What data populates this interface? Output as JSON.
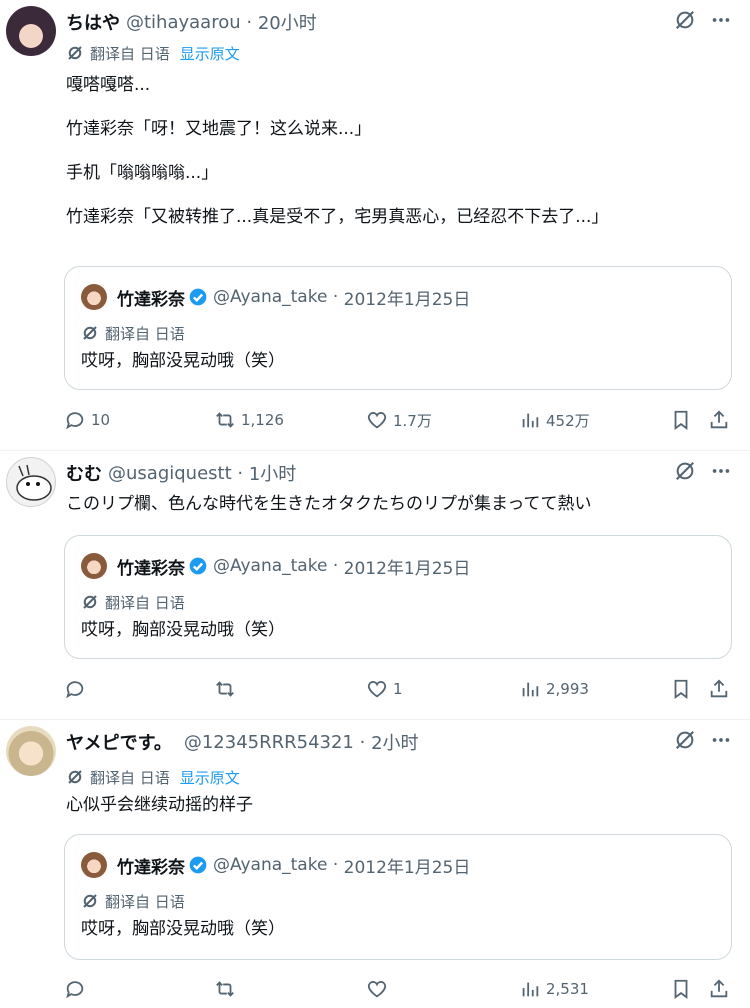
{
  "quoted": {
    "name": "竹達彩奈",
    "handle": "@Ayana_take",
    "date": "2012年1月25日",
    "translated_from": "翻译自 日语",
    "text": "哎呀，胸部没晃动哦（笑）"
  },
  "tweets": [
    {
      "name": "ちはや",
      "handle": "@tihayaarou",
      "time": "20小时",
      "translated_from": "翻译自 日语",
      "show_original": "显示原文",
      "text": "嘎嗒嘎嗒...\n\n竹達彩奈「呀！又地震了！这么说来...」\n\n手机「嗡嗡嗡嗡...」\n\n竹達彩奈「又被转推了...真是受不了，宅男真恶心，已经忍不下去了...」",
      "replies": "10",
      "retweets": "1,126",
      "likes": "1.7万",
      "views": "452万"
    },
    {
      "name": "むむ",
      "handle": "@usagiquestt",
      "time": "1小时",
      "text": "このリプ欄、色んな時代を生きたオタクたちのリプが集まってて熱い",
      "replies": "",
      "retweets": "",
      "likes": "1",
      "views": "2,993"
    },
    {
      "name": "ヤメピです。",
      "handle": "@12345RRR54321",
      "time": "2小时",
      "translated_from": "翻译自 日语",
      "show_original": "显示原文",
      "text": "心似乎会继续动摇的样子",
      "replies": "",
      "retweets": "",
      "likes": "",
      "views": "2,531"
    }
  ],
  "colors": {
    "accent": "#1d9bf0",
    "secondary_text": "#536471",
    "border": "#cfd9de"
  }
}
